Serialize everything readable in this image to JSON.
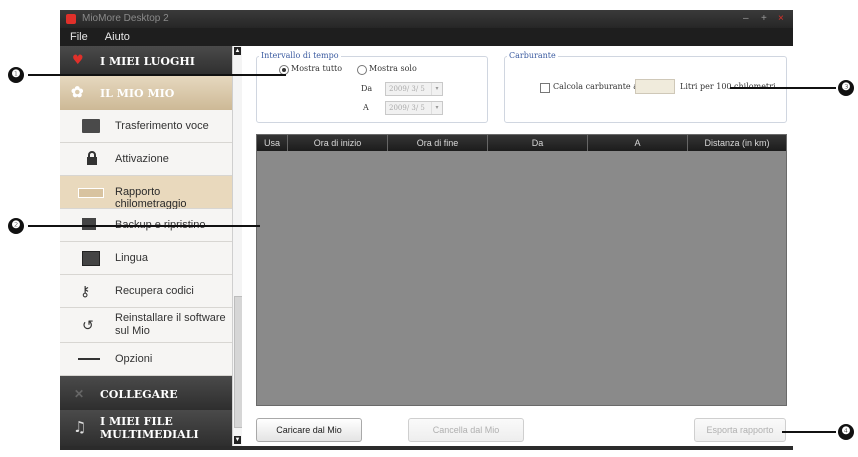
{
  "window": {
    "title": "MioMore Desktop 2",
    "controls": [
      "–",
      "+",
      "×"
    ]
  },
  "menu": [
    "File",
    "Aiuto"
  ],
  "sidebar": {
    "sections": [
      {
        "label": "I MIEI LUOGHI",
        "icon": "heart-icon"
      },
      {
        "label": "IL MIO MIO",
        "icon": "gear-icon"
      }
    ],
    "items": [
      {
        "label": "Trasferimento voce",
        "icon": "voice-transfer-icon"
      },
      {
        "label": "Attivazione",
        "icon": "lock-icon"
      },
      {
        "label": "Rapporto chilometraggio",
        "icon": "odometer-icon"
      },
      {
        "label": "Backup e ripristino",
        "icon": "backup-icon"
      },
      {
        "label": "Lingua",
        "icon": "language-icon"
      },
      {
        "label": "Recupera codici",
        "icon": "key-icon"
      },
      {
        "label": "Reinstallare il software sul Mio",
        "label_line1": "Reinstallare il software",
        "label_line2": "sul Mio",
        "icon": "reinstall-icon"
      },
      {
        "label": "Opzioni",
        "icon": "options-icon"
      }
    ],
    "bottom_sections": [
      {
        "label": "COLLEGARE",
        "icon": "connect-icon"
      },
      {
        "label": "I MIEI FILE MULTIMEDIALI",
        "label_line1": "I MIEI FILE",
        "label_line2": "MULTIMEDIALI",
        "icon": "music-icon"
      }
    ],
    "selected_item": "Rapporto chilometraggio"
  },
  "time_interval": {
    "legend": "Intervallo di tempo",
    "show_all": "Mostra tutto",
    "show_only": "Mostra solo",
    "selected": "Mostra tutto",
    "from_label": "Da",
    "to_label": "A",
    "from_value": "2009/ 3/ 5",
    "to_value": "2009/ 3/ 5"
  },
  "fuel": {
    "legend": "Carburante",
    "checkbox_label": "Calcola carburante a",
    "checked": false,
    "value": "",
    "unit": "Litri per 100 chilometri"
  },
  "table": {
    "columns": [
      "Usa",
      "Ora di inizio",
      "Ora di fine",
      "Da",
      "A",
      "Distanza (in km)"
    ],
    "rows": []
  },
  "buttons": {
    "load": "Caricare dal Mio",
    "delete": "Cancella dal Mio",
    "export": "Esporta rapporto"
  },
  "callouts": [
    "❶",
    "❷",
    "❸",
    "❹"
  ],
  "colors": {
    "accent": "#e0302a",
    "selected_bg": "#e9d9bd",
    "table_bg": "#8a8a8a"
  }
}
